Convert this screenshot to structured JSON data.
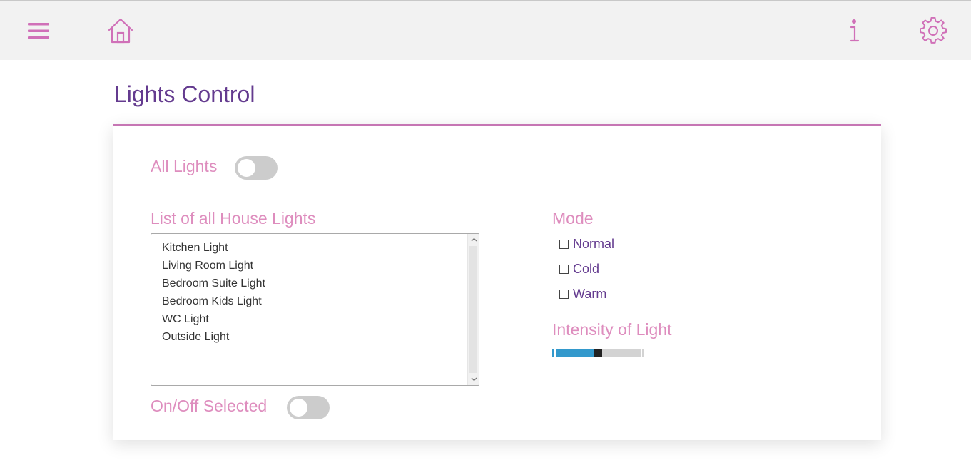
{
  "header": {
    "menu_icon": "hamburger-menu-icon",
    "home_icon": "home-icon",
    "info_icon": "info-icon",
    "settings_icon": "gear-icon",
    "accent_color": "#d070b8"
  },
  "page": {
    "title": "Lights Control"
  },
  "all_lights": {
    "label": "All Lights",
    "on": false
  },
  "house_lights": {
    "label": "List of all House Lights",
    "items": [
      "Kitchen Light",
      "Living Room Light",
      "Bedroom Suite Light",
      "Bedroom Kids Light",
      "WC Light",
      "Outside Light"
    ]
  },
  "on_off_selected": {
    "label": "On/Off Selected",
    "on": false
  },
  "mode": {
    "label": "Mode",
    "options": [
      {
        "label": "Normal",
        "checked": false
      },
      {
        "label": "Cold",
        "checked": false
      },
      {
        "label": "Warm",
        "checked": false
      }
    ]
  },
  "intensity": {
    "label": "Intensity of Light",
    "value": 50,
    "min": 0,
    "max": 100,
    "fill_color": "#3399cc"
  },
  "colors": {
    "title": "#643b8f",
    "label": "#de8dbe",
    "card_border": "#c676b4"
  }
}
